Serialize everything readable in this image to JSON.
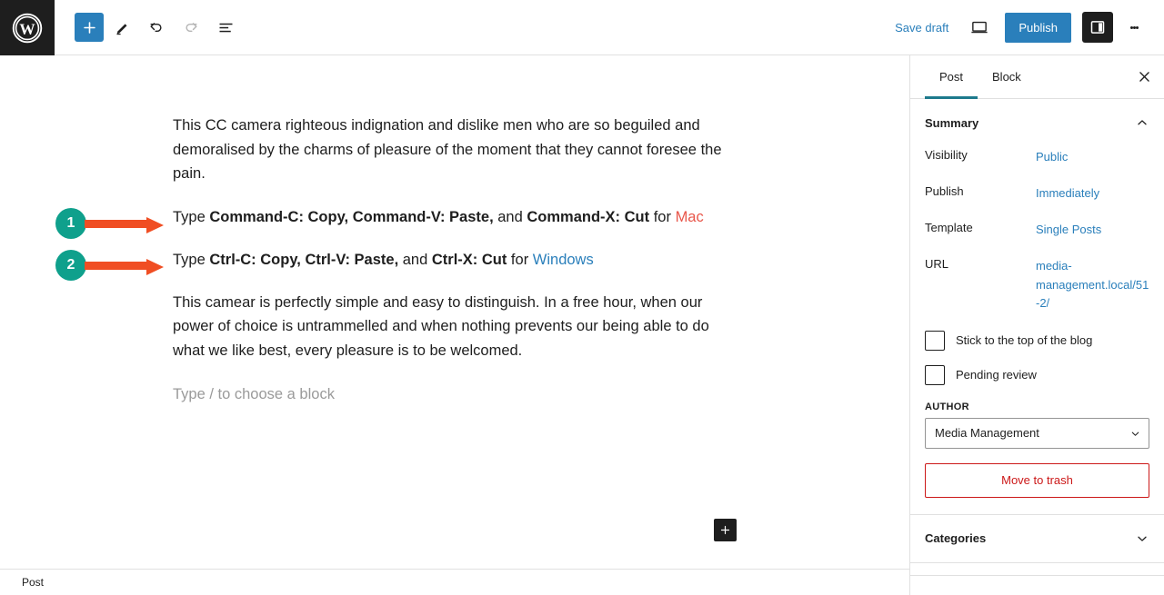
{
  "topbar": {
    "logo_icon": "wordpress-logo-icon",
    "add_block_icon": "plus-icon",
    "edit_icon": "pencil-icon",
    "undo_icon": "undo-arrow-icon",
    "redo_icon": "redo-arrow-icon",
    "listview_icon": "list-view-icon",
    "save_draft_label": "Save draft",
    "preview_icon": "desktop-preview-icon",
    "publish_label": "Publish",
    "settings_icon": "sidebar-panel-icon",
    "options_icon": "kebab-menu-icon",
    "accent_color": "#2a7fbb"
  },
  "editor": {
    "paragraph_1": "This CC camera righteous indignation and dislike men who are so beguiled and demoralised by the charms of pleasure of the moment that they cannot foresee the pain.",
    "line_mac": {
      "prefix": "Type ",
      "bold_1": "Command-C: Copy, Command-V: Paste,",
      "mid": " and ",
      "bold_2": "Command-X: Cut",
      "suffix": " for ",
      "link": "Mac",
      "link_color": "#e8564a"
    },
    "line_windows": {
      "prefix": "Type ",
      "bold_1": "Ctrl-C: Copy, Ctrl-V: Paste,",
      "mid": " and ",
      "bold_2": "Ctrl-X: Cut",
      "suffix": " for ",
      "link": "Windows",
      "link_color": "#2a7fbb"
    },
    "paragraph_2": "This camear is perfectly simple and easy to distinguish. In a free hour, when our power of choice is untrammelled and when nothing prevents our being able to do what we like best, every pleasure is to be welcomed.",
    "placeholder": "Type / to choose a block",
    "add_block_icon": "plus-icon",
    "breadcrumb": "Post"
  },
  "annotations": {
    "marker_color": "#0fa08c",
    "arrow_color": "#f04e23",
    "markers": [
      {
        "number": "1"
      },
      {
        "number": "2"
      }
    ]
  },
  "sidebar": {
    "tabs": [
      {
        "label": "Post",
        "active": true
      },
      {
        "label": "Block",
        "active": false
      }
    ],
    "close_icon": "close-x-icon",
    "summary": {
      "title": "Summary",
      "collapse_icon": "chevron-up-icon",
      "rows": [
        {
          "label": "Visibility",
          "value": "Public"
        },
        {
          "label": "Publish",
          "value": "Immediately"
        },
        {
          "label": "Template",
          "value": "Single Posts"
        },
        {
          "label": "URL",
          "value": "media-management.local/51-2/"
        }
      ],
      "checkboxes": [
        {
          "label": "Stick to the top of the blog",
          "checked": false
        },
        {
          "label": "Pending review",
          "checked": false
        }
      ],
      "author_label": "AUTHOR",
      "author_value": "Media Management",
      "author_chevron_icon": "chevron-down-icon",
      "trash_label": "Move to trash",
      "trash_color": "#cc1818"
    },
    "categories": {
      "title": "Categories",
      "expand_icon": "chevron-down-icon"
    }
  }
}
